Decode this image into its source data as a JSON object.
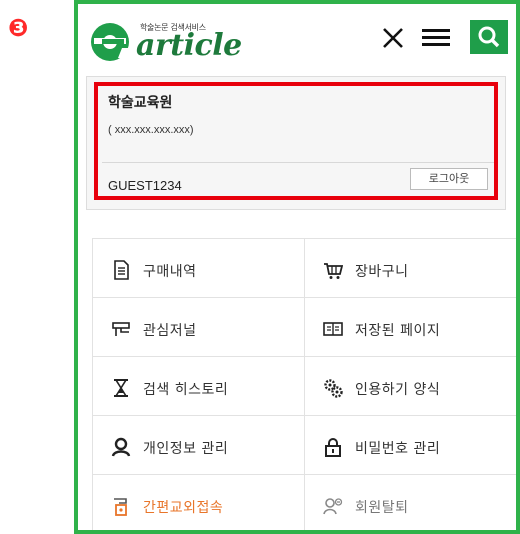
{
  "step_number": "❸",
  "header": {
    "logo_tagline": "학술논문 검색서비스",
    "logo_word": "article",
    "close_label": "close",
    "menu_label": "menu",
    "search_label": "search"
  },
  "user": {
    "org_name": "학술교육원",
    "ip": "( xxx.xxx.xxx.xxx)",
    "user_id": "GUEST1234",
    "logout_label": "로그아웃"
  },
  "menu": {
    "items": [
      {
        "label": "구매내역",
        "icon": "document-icon"
      },
      {
        "label": "장바구니",
        "icon": "cart-icon"
      },
      {
        "label": "관심저널",
        "icon": "journal-icon"
      },
      {
        "label": "저장된 페이지",
        "icon": "saved-page-icon"
      },
      {
        "label": "검색 히스토리",
        "icon": "hourglass-icon"
      },
      {
        "label": "인용하기 양식",
        "icon": "gears-icon"
      },
      {
        "label": "개인정보 관리",
        "icon": "person-icon"
      },
      {
        "label": "비밀번호 관리",
        "icon": "lock-icon"
      },
      {
        "label": "간편교외접속",
        "icon": "remote-access-icon"
      },
      {
        "label": "회원탈퇴",
        "icon": "withdraw-icon"
      }
    ]
  },
  "colors": {
    "frame_green": "#2fb24a",
    "brand_green": "#1f9e4a",
    "highlight_red": "#e8000c",
    "accent_orange": "#e8752a"
  }
}
